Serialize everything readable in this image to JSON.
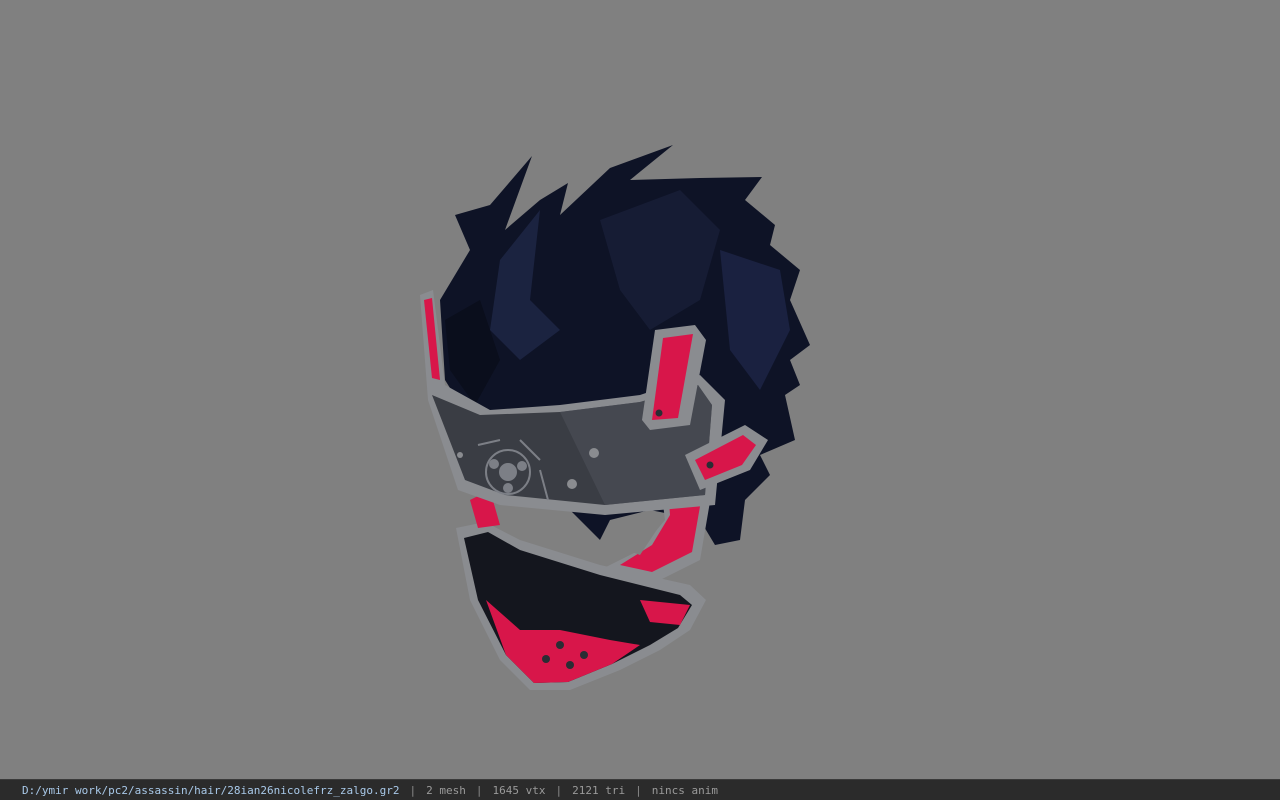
{
  "viewport": {
    "background": "#808080",
    "model": {
      "name": "hair-mask-model",
      "colors": {
        "hair": "#0e1326",
        "hair_shade": "#1b2340",
        "plate_grey": "#3a3d44",
        "rim_grey": "#8a8c90",
        "accent_red": "#d8164a",
        "mask_dark": "#14161e"
      }
    }
  },
  "statusbar": {
    "path": "D:/ymir work/pc2/assassin/hair/28ian26nicolefrz_zalgo.gr2",
    "separator": "|",
    "mesh": "2 mesh",
    "vtx": "1645 vtx",
    "tri": "2121 tri",
    "anim": "nincs anim"
  }
}
